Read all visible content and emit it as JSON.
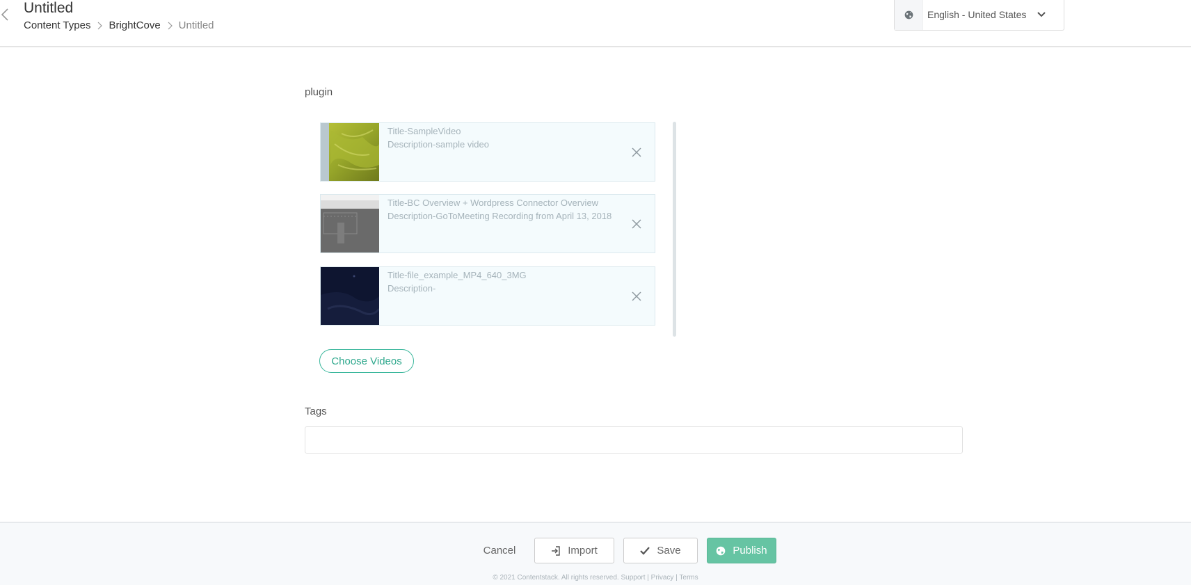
{
  "header": {
    "title": "Untitled",
    "breadcrumb": [
      "Content Types",
      "BrightCove",
      "Untitled"
    ],
    "language": "English - United States"
  },
  "plugin": {
    "label": "plugin",
    "videos": [
      {
        "title": "Title-SampleVideo",
        "description": "Description-sample video"
      },
      {
        "title": "Title-BC Overview + Wordpress Connector Overview",
        "description": "Description-GoToMeeting Recording from April 13, 2018"
      },
      {
        "title": "Title-file_example_MP4_640_3MG",
        "description": "Description-"
      }
    ],
    "choose_label": "Choose Videos"
  },
  "tags": {
    "label": "Tags",
    "value": "",
    "placeholder": ""
  },
  "footer": {
    "cancel": "Cancel",
    "import": "Import",
    "save": "Save",
    "publish": "Publish",
    "copyright": "© 2021 Contentstack. All rights reserved. Support | Privacy | Terms"
  },
  "colors": {
    "accent": "#3bb79c",
    "publish": "#66c4a3",
    "card_bg": "#f4fbfd"
  }
}
